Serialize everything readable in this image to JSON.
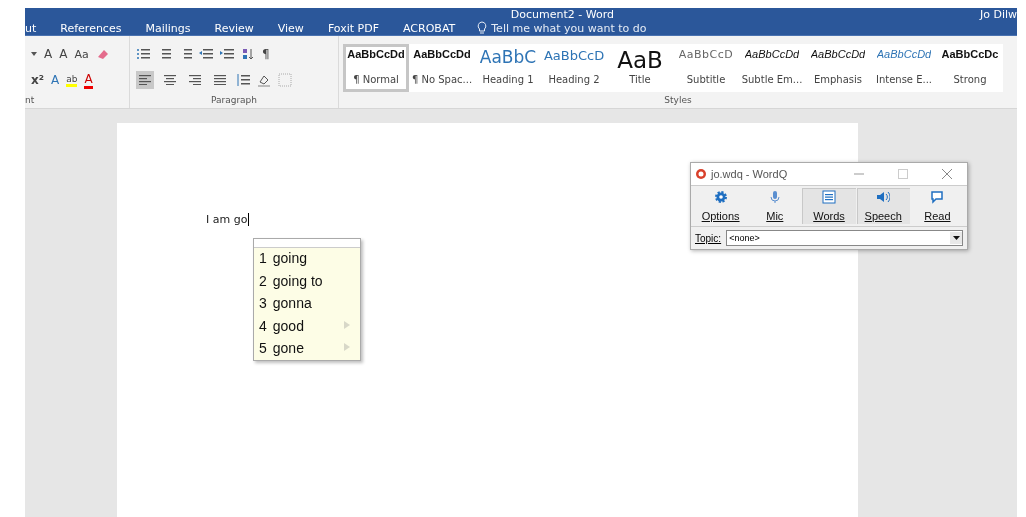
{
  "window": {
    "title": "Document2  -  Word",
    "user": "Jo Dilw"
  },
  "tabs": [
    {
      "label": "ut",
      "selected": false
    },
    {
      "label": "References",
      "selected": false
    },
    {
      "label": "Mailings",
      "selected": false
    },
    {
      "label": "Review",
      "selected": false
    },
    {
      "label": "View",
      "selected": false
    },
    {
      "label": "Foxit PDF",
      "selected": false
    },
    {
      "label": "ACROBAT",
      "selected": false
    }
  ],
  "tell_me": {
    "placeholder": "Tell me what you want to do"
  },
  "font_group": {
    "label": "nt",
    "row1": [
      "A",
      "A",
      "Aa"
    ],
    "row2": [
      "x²",
      "A",
      "ab",
      "A"
    ]
  },
  "paragraph_group": {
    "label": "Paragraph",
    "pilcrow": "¶",
    "align": [
      {
        "selected": true
      },
      {
        "selected": false
      },
      {
        "selected": false
      },
      {
        "selected": false
      }
    ]
  },
  "styles": {
    "label": "Styles",
    "items": [
      {
        "kind": "normal",
        "sample": "AaBbCcDd",
        "name": "¶ Normal",
        "selected": true
      },
      {
        "kind": "normal",
        "sample": "AaBbCcDd",
        "name": "¶ No Spac...",
        "selected": false
      },
      {
        "kind": "heading1",
        "sample": "AaBbC",
        "name": "Heading 1",
        "selected": false
      },
      {
        "kind": "heading2",
        "sample": "AaBbCcD",
        "name": "Heading 2",
        "selected": false
      },
      {
        "kind": "title",
        "sample": "AaB",
        "name": "Title",
        "selected": false
      },
      {
        "kind": "subtitle",
        "sample": "AaBbCcD",
        "name": "Subtitle",
        "selected": false
      },
      {
        "kind": "subtle",
        "sample": "AaBbCcDd",
        "name": "Subtle Em...",
        "selected": false
      },
      {
        "kind": "emphasis",
        "sample": "AaBbCcDd",
        "name": "Emphasis",
        "selected": false
      },
      {
        "kind": "intense",
        "sample": "AaBbCcDd",
        "name": "Intense E...",
        "selected": false
      },
      {
        "kind": "strong",
        "sample": "AaBbCcDc",
        "name": "Strong",
        "selected": false
      }
    ]
  },
  "document": {
    "text": "I am go"
  },
  "predictions": [
    {
      "number": "1",
      "word": "going",
      "more": false
    },
    {
      "number": "2",
      "word": "going to",
      "more": false
    },
    {
      "number": "3",
      "word": "gonna",
      "more": false
    },
    {
      "number": "4",
      "word": "good",
      "more": true
    },
    {
      "number": "5",
      "word": "gone",
      "more": true
    }
  ],
  "wordq": {
    "title": "jo.wdq - WordQ",
    "buttons": [
      {
        "kind": "options",
        "label": "Options",
        "selected": false
      },
      {
        "kind": "mic",
        "label": "Mic",
        "selected": false
      },
      {
        "kind": "words",
        "label": "Words",
        "selected": true
      },
      {
        "kind": "speech",
        "label": "Speech",
        "selected": true
      },
      {
        "kind": "read",
        "label": "Read",
        "selected": false
      }
    ],
    "topic_label": "Topic:",
    "topic": "<none>"
  }
}
